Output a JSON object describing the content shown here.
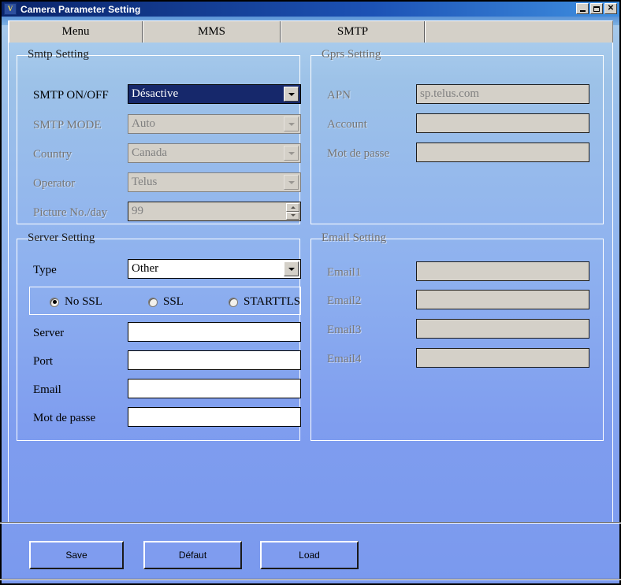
{
  "window": {
    "title": "Camera Parameter Setting",
    "icon": "camera-app-icon",
    "controls": {
      "minimize": "minimize-icon",
      "maximize": "maximize-icon",
      "close": "close-icon"
    }
  },
  "tabs": [
    {
      "label": "Menu",
      "selected": false
    },
    {
      "label": "MMS",
      "selected": false
    },
    {
      "label": "SMTP",
      "selected": true
    }
  ],
  "smtp_setting": {
    "legend": "Smtp Setting",
    "fields": {
      "smtp_onoff": {
        "label": "SMTP ON/OFF",
        "value": "Désactive",
        "disabled": false,
        "selected": true
      },
      "smtp_mode": {
        "label": "SMTP MODE",
        "value": "Auto",
        "disabled": true
      },
      "country": {
        "label": "Country",
        "value": "Canada",
        "disabled": true
      },
      "operator": {
        "label": "Operator",
        "value": "Telus",
        "disabled": true
      },
      "picture_no": {
        "label": "Picture No./day",
        "value": "99",
        "disabled": true
      }
    }
  },
  "gprs_setting": {
    "legend": "Gprs Setting",
    "disabled": true,
    "fields": {
      "apn": {
        "label": "APN",
        "value": "sp.telus.com"
      },
      "account": {
        "label": "Account",
        "value": ""
      },
      "password": {
        "label": "Mot de passe",
        "value": ""
      }
    }
  },
  "server_setting": {
    "legend": "Server Setting",
    "type": {
      "label": "Type",
      "value": "Other"
    },
    "ssl_options": [
      {
        "label": "No SSL",
        "checked": true
      },
      {
        "label": "SSL",
        "checked": false
      },
      {
        "label": "STARTTLS",
        "checked": false
      }
    ],
    "fields": {
      "server": {
        "label": "Server",
        "value": ""
      },
      "port": {
        "label": "Port",
        "value": ""
      },
      "email": {
        "label": "Email",
        "value": ""
      },
      "password": {
        "label": "Mot de passe",
        "value": ""
      }
    }
  },
  "email_setting": {
    "legend": "Email Setting",
    "disabled": true,
    "fields": [
      {
        "label": "Email1",
        "value": ""
      },
      {
        "label": "Email2",
        "value": ""
      },
      {
        "label": "Email3",
        "value": ""
      },
      {
        "label": "Email4",
        "value": ""
      }
    ]
  },
  "footer": {
    "buttons": [
      {
        "label": "Save"
      },
      {
        "label": "Défaut"
      },
      {
        "label": "Load"
      }
    ]
  },
  "colors": {
    "titlebar_start": "#0a246a",
    "titlebar_end": "#3f8fe0",
    "page_bg_top": "#a6c9eb",
    "page_bg_bottom": "#7a99ee",
    "tab_face": "#d4d0c8",
    "combo_selected_bg": "#16286b",
    "disabled_field_bg": "#d4d0c8",
    "disabled_text": "#808080",
    "button_face": "#7f9cef"
  }
}
